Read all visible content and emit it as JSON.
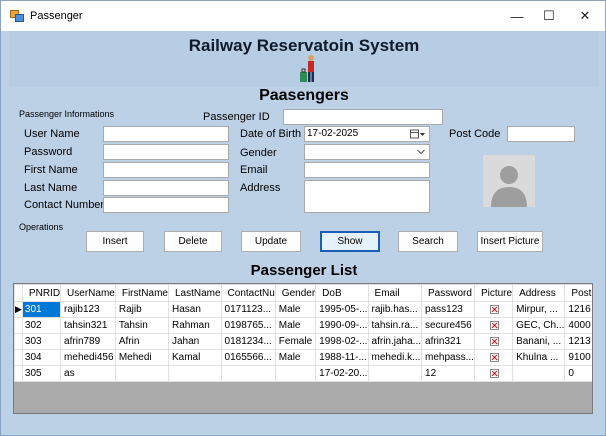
{
  "window": {
    "title": "Passenger",
    "minimize": "—",
    "maximize": "☐",
    "close": "✕"
  },
  "header": {
    "title": "Railway Reservatoin System"
  },
  "section_title": "Paasengers",
  "form": {
    "group_label": "Passenger Informations",
    "passenger_id_label": "Passenger ID",
    "passenger_id_value": "",
    "username_label": "User Name",
    "password_label": "Password",
    "firstname_label": "First Name",
    "lastname_label": "Last Name",
    "contact_label": "Contact Number",
    "dob_label": "Date of Birth",
    "dob_value": "17-02-2025",
    "gender_label": "Gender",
    "email_label": "Email",
    "address_label": "Address",
    "postcode_label": "Post Code"
  },
  "operations": {
    "label": "Operations",
    "insert": "Insert",
    "delete": "Delete",
    "update": "Update",
    "show": "Show",
    "search": "Search",
    "insert_picture": "Insert Picture"
  },
  "list": {
    "title": "Passenger List",
    "columns": [
      "PNRID",
      "UserName",
      "FirstName",
      "LastName",
      "ContactNu",
      "Gender",
      "DoB",
      "Email",
      "Password",
      "Picture",
      "Address",
      "PostCode"
    ],
    "rows": [
      {
        "marker": "▶",
        "pnrid": "301",
        "username": "rajib123",
        "firstname": "Rajib",
        "lastname": "Hasan",
        "contact": "0171123...",
        "gender": "Male",
        "dob": "1995-05-...",
        "email": "rajib.has...",
        "password": "pass123",
        "picture": true,
        "address": "Mirpur, ...",
        "postcode": "1216"
      },
      {
        "marker": "",
        "pnrid": "302",
        "username": "tahsin321",
        "firstname": "Tahsin",
        "lastname": "Rahman",
        "contact": "0198765...",
        "gender": "Male",
        "dob": "1990-09-...",
        "email": "tahsin.ra...",
        "password": "secure456",
        "picture": true,
        "address": "GEC, Ch...",
        "postcode": "4000"
      },
      {
        "marker": "",
        "pnrid": "303",
        "username": "afrin789",
        "firstname": "Afrin",
        "lastname": "Jahan",
        "contact": "0181234...",
        "gender": "Female",
        "dob": "1998-02-...",
        "email": "afrin.jaha...",
        "password": "afrin321",
        "picture": true,
        "address": "Banani, ...",
        "postcode": "1213"
      },
      {
        "marker": "",
        "pnrid": "304",
        "username": "mehedi456",
        "firstname": "Mehedi",
        "lastname": "Kamal",
        "contact": "0165566...",
        "gender": "Male",
        "dob": "1988-11-...",
        "email": "mehedi.k...",
        "password": "mehpass...",
        "picture": true,
        "address": "Khulna ...",
        "postcode": "9100"
      },
      {
        "marker": "",
        "pnrid": "305",
        "username": "as",
        "firstname": "",
        "lastname": "",
        "contact": "",
        "gender": "",
        "dob": "17-02-20...",
        "email": "",
        "password": "12",
        "picture": true,
        "address": "",
        "postcode": "0"
      }
    ]
  },
  "icons": {
    "app": "app-icon",
    "mascot": "person-with-luggage-icon",
    "avatar": "user-avatar-icon",
    "calendar": "calendar-icon",
    "dropdown": "chevron-down-icon",
    "picture_missing": "broken-image-icon"
  },
  "colors": {
    "background": "#bcd0e6",
    "selection": "#0078d7",
    "focus_border": "#1b5fb4",
    "missing_image": "#dd0000"
  }
}
